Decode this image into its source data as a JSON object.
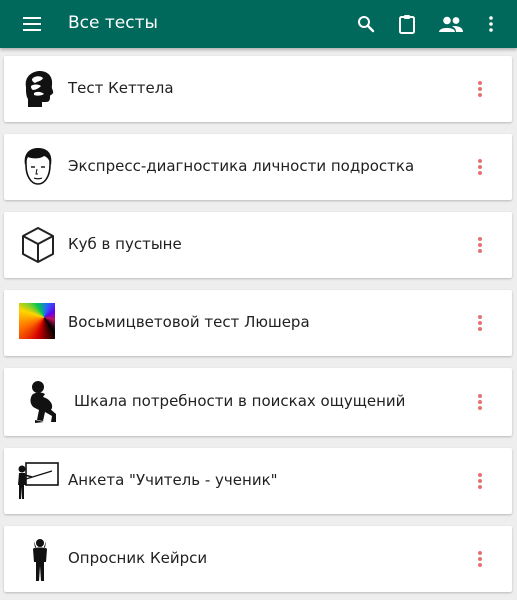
{
  "colors": {
    "primary": "#00695c",
    "accent": "#e57373",
    "background": "#eeeeee"
  },
  "appbar": {
    "title": "Все тесты",
    "menu_icon": "hamburger-menu-icon",
    "actions": [
      "search-icon",
      "clipboard-icon",
      "people-icon",
      "more-vert-icon"
    ]
  },
  "tests": [
    {
      "title": "Тест Кеттела",
      "icon": "head-profile-icon"
    },
    {
      "title": "Экспресс-диагностика личности подростка",
      "icon": "teen-face-icon"
    },
    {
      "title": "Куб в пустыне",
      "icon": "cube-icon"
    },
    {
      "title": "Восьмицветовой тест Люшера",
      "icon": "color-spectrum-icon"
    },
    {
      "title": "Шкала потребности в поисках ощущений",
      "icon": "thinker-icon"
    },
    {
      "title": "Анкета \"Учитель - ученик\"",
      "icon": "teacher-board-icon"
    },
    {
      "title": "Опросник Кейрси",
      "icon": "person-standing-icon"
    }
  ]
}
